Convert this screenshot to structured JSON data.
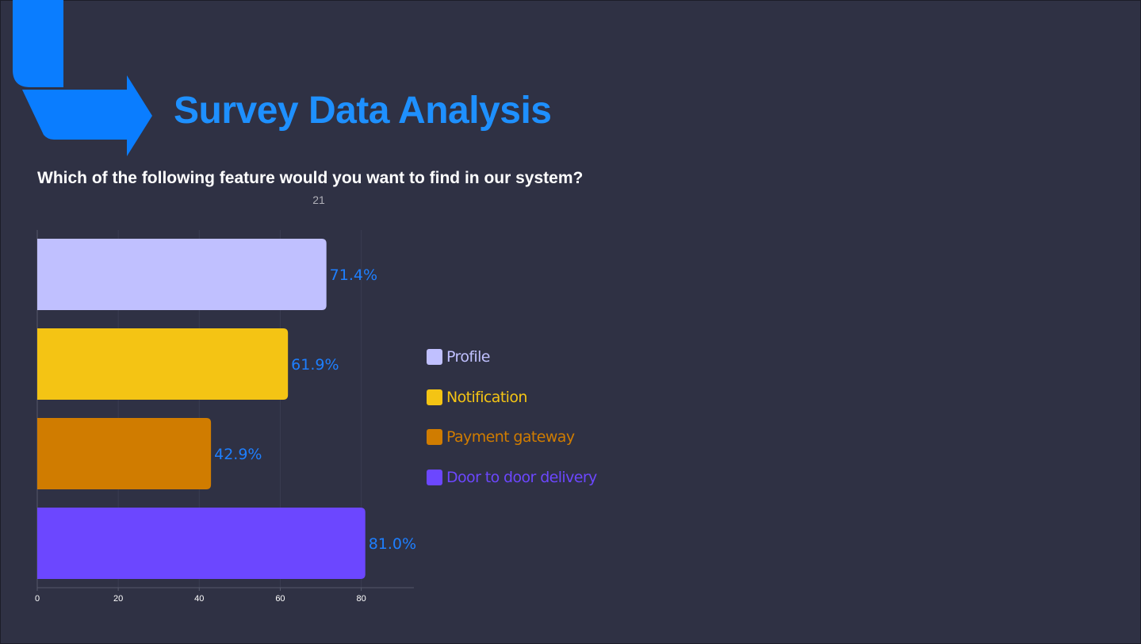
{
  "header": {
    "title": "Survey Data Analysis",
    "brand_color": "#1e90ff",
    "logo_icon": "arrow-corner-icon"
  },
  "question": "Which of the following feature would you want to find in our system?",
  "response_count": "21",
  "chart_data": {
    "type": "bar",
    "orientation": "horizontal",
    "categories": [
      "Profile",
      "Notification",
      "Payment gateway",
      "Door to door delivery"
    ],
    "values": [
      71.4,
      61.9,
      42.9,
      81.0
    ],
    "value_labels": [
      "71.4%",
      "61.9%",
      "42.9%",
      "81.0%"
    ],
    "colors": [
      "#c0c0ff",
      "#f4c414",
      "#d07c00",
      "#6c47ff"
    ],
    "xlim": [
      0,
      93
    ],
    "xticks": [
      0,
      20,
      40,
      60,
      80
    ],
    "grid": true,
    "legend_position": "right"
  }
}
